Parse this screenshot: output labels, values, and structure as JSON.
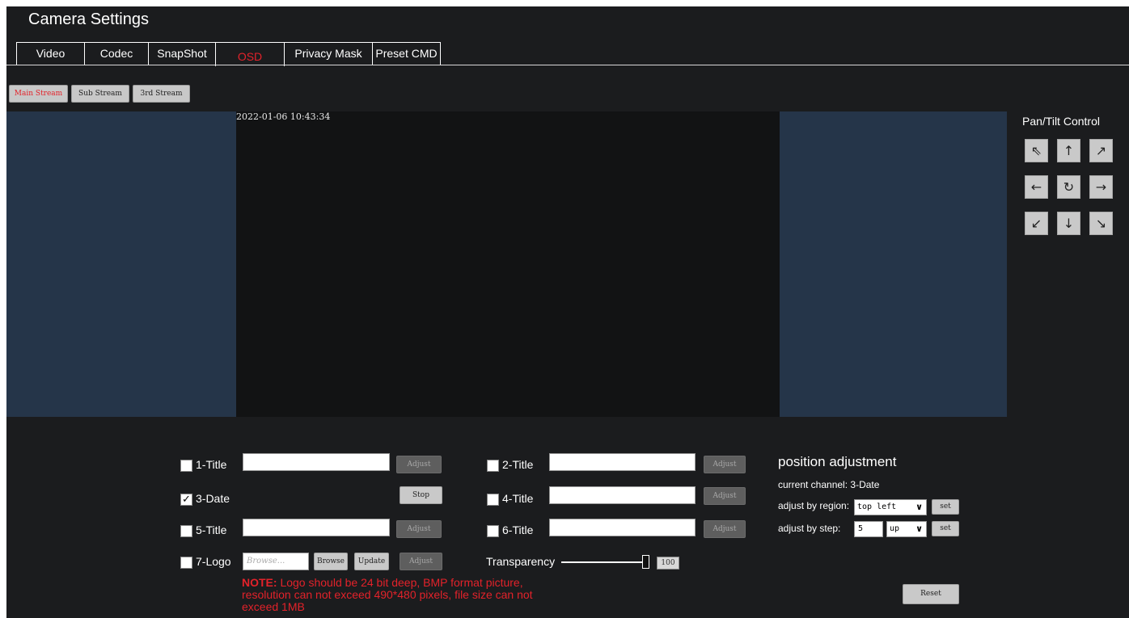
{
  "header": {
    "title": "Camera Settings"
  },
  "tabs": [
    {
      "label": "Video"
    },
    {
      "label": "Codec"
    },
    {
      "label": "SnapShot"
    },
    {
      "label": "OSD"
    },
    {
      "label": "Privacy Mask"
    },
    {
      "label": "Preset CMD"
    }
  ],
  "active_tab": "OSD",
  "streams": [
    {
      "label": "Main Stream",
      "active": true
    },
    {
      "label": "Sub Stream",
      "active": false
    },
    {
      "label": "3rd Stream",
      "active": false
    }
  ],
  "preview": {
    "timestamp": "2022-01-06 10:43:34"
  },
  "ptz": {
    "title": "Pan/Tilt Control",
    "buttons": [
      {
        "icon": "arrow-up-left-icon",
        "glyph": "⇖"
      },
      {
        "icon": "arrow-up-icon",
        "glyph": "↑"
      },
      {
        "icon": "arrow-up-right-icon",
        "glyph": "↗"
      },
      {
        "icon": "arrow-left-icon",
        "glyph": "←"
      },
      {
        "icon": "refresh-icon",
        "glyph": "↻"
      },
      {
        "icon": "arrow-right-icon",
        "glyph": "→"
      },
      {
        "icon": "arrow-down-left-icon",
        "glyph": "↙"
      },
      {
        "icon": "arrow-down-icon",
        "glyph": "↓"
      },
      {
        "icon": "arrow-down-right-icon",
        "glyph": "↘"
      }
    ]
  },
  "osd": {
    "items": [
      {
        "label": "1-Title",
        "checked": false,
        "value": "",
        "button": "Adjust"
      },
      {
        "label": "2-Title",
        "checked": false,
        "value": "",
        "button": "Adjust"
      },
      {
        "label": "3-Date",
        "checked": true,
        "button": "Stop"
      },
      {
        "label": "4-Title",
        "checked": false,
        "value": "",
        "button": "Adjust"
      },
      {
        "label": "5-Title",
        "checked": false,
        "value": "",
        "button": "Adjust"
      },
      {
        "label": "6-Title",
        "checked": false,
        "value": "",
        "button": "Adjust"
      },
      {
        "label": "7-Logo",
        "checked": false,
        "button": "Adjust"
      }
    ],
    "logo": {
      "placeholder": "Browse...",
      "browse_label": "Browse",
      "update_label": "Update"
    },
    "transparency": {
      "label": "Transparency",
      "value": "100"
    },
    "note": {
      "prefix": "NOTE:",
      "text": " Logo should be 24 bit deep, BMP format picture, resolution can not exceed 490*480 pixels, file size can not exceed 1MB"
    }
  },
  "position": {
    "title": "position adjustment",
    "current_channel_label": "current channel:",
    "current_channel_value": "3-Date",
    "region_label": "adjust by region:",
    "region_value": "top left",
    "step_label": "adjust by step:",
    "step_value": "5",
    "direction_value": "up",
    "set_label": "set",
    "reset_label": "Reset"
  },
  "colors": {
    "accent": "#e3222a",
    "background": "#1b1c1e",
    "preview_bg": "#253549"
  }
}
